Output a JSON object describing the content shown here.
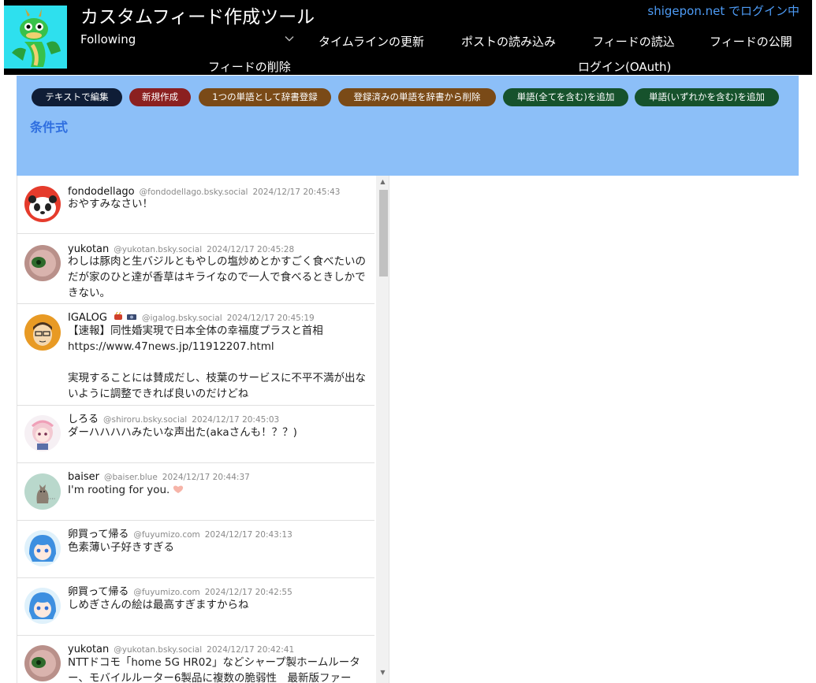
{
  "app": {
    "title": "カスタムフィード作成ツール",
    "login_status": "shigepon.net でログイン中"
  },
  "header": {
    "feed_select_value": "Following",
    "nav": {
      "update_timeline": "タイムラインの更新",
      "load_posts": "ポストの読み込み",
      "load_feed": "フィードの読込",
      "publish_feed": "フィードの公開",
      "delete_feed": "フィードの削除",
      "login_oauth": "ログイン(OAuth)"
    }
  },
  "conditions": {
    "heading": "条件式",
    "buttons": {
      "edit_text": "テキストで編集",
      "new": "新規作成",
      "register_word": "1つの単語として辞書登録",
      "remove_word": "登録済みの単語を辞書から削除",
      "add_all": "単語(全てを含む)を追加",
      "add_any": "単語(いずれかを含む)を追加"
    }
  },
  "colors": {
    "header_bg": "#000000",
    "panel_bg": "#8cbff8",
    "btn_navy": "#0f1d36",
    "btn_red": "#8b2020",
    "btn_brown": "#7a4a17",
    "btn_green": "#16522c",
    "link_blue": "#4d9bf5"
  },
  "posts": [
    {
      "author": "fondodellago",
      "handle": "@fondodellago.bsky.social",
      "time": "2024/12/17 20:45:43",
      "body": "おやすみなさい！"
    },
    {
      "author": "yukotan",
      "handle": "@yukotan.bsky.social",
      "time": "2024/12/17 20:45:28",
      "body": "わしは豚肉と生バジルともやしの塩炒めとかすごく食べたいのだが家のひと達が香草はキライなので一人で食べるときしかできない。"
    },
    {
      "author": "IGALOG",
      "handle": "@igalog.bsky.social",
      "time": "2024/12/17 20:45:19",
      "body": "【速報】同性婚実現で日本全体の幸福度プラスと首相\nhttps://www.47news.jp/11912207.html\n\n実現することには賛成だし、枝葉のサービスに不平不満が出ないように調整できれば良いのだけどね"
    },
    {
      "author": "しろる",
      "handle": "@shiroru.bsky.social",
      "time": "2024/12/17 20:45:03",
      "body": "ダーハハハハみたいな声出た(akaさんも！？？)"
    },
    {
      "author": "baiser",
      "handle": "@baiser.blue",
      "time": "2024/12/17 20:44:37",
      "body": "I'm rooting for you."
    },
    {
      "author": "卵買って帰る",
      "handle": "@fuyumizo.com",
      "time": "2024/12/17 20:43:13",
      "body": "色素薄い子好きすぎる"
    },
    {
      "author": "卵買って帰る",
      "handle": "@fuyumizo.com",
      "time": "2024/12/17 20:42:55",
      "body": "しめぎさんの絵は最高すぎますからね"
    },
    {
      "author": "yukotan",
      "handle": "@yukotan.bsky.social",
      "time": "2024/12/17 20:42:41",
      "body": "NTTドコモ「home 5G HR02」などシャープ製ホームルーター、モバイルルーター6製品に複数の脆弱性　最新版ファー"
    }
  ]
}
